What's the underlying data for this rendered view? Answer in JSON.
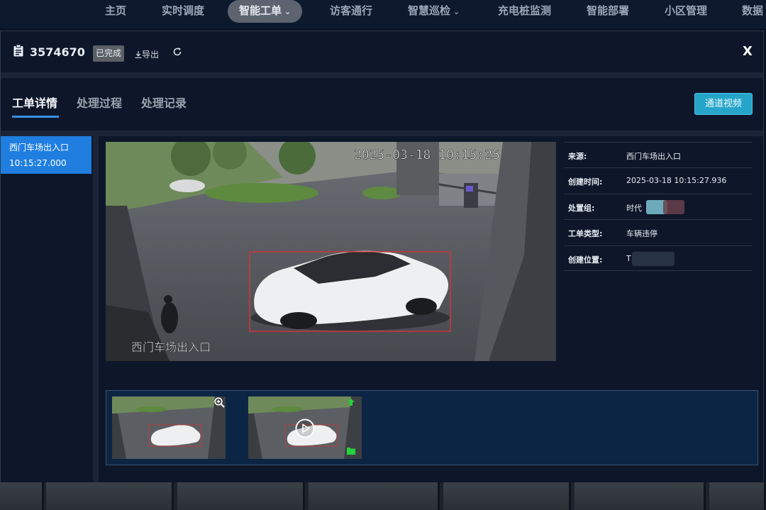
{
  "topnav": {
    "items": [
      {
        "label": "主页",
        "has_dropdown": false,
        "active": false
      },
      {
        "label": "实时调度",
        "has_dropdown": false,
        "active": false
      },
      {
        "label": "智能工单",
        "has_dropdown": true,
        "active": true
      },
      {
        "label": "访客通行",
        "has_dropdown": false,
        "active": false
      },
      {
        "label": "智慧巡检",
        "has_dropdown": true,
        "active": false
      },
      {
        "label": "充电桩监测",
        "has_dropdown": false,
        "active": false
      },
      {
        "label": "智能部署",
        "has_dropdown": false,
        "active": false
      },
      {
        "label": "小区管理",
        "has_dropdown": false,
        "active": false
      },
      {
        "label": "数据",
        "has_dropdown": false,
        "active": false
      }
    ],
    "chevron": "⌄"
  },
  "modal": {
    "order_id": "3574670",
    "status": "已完成",
    "export_label": "导出",
    "close_label": "X",
    "tabs": [
      {
        "label": "工单详情",
        "active": true
      },
      {
        "label": "处理过程",
        "active": false
      },
      {
        "label": "处理记录",
        "active": false
      }
    ],
    "channel_video_label": "通道视频",
    "sidebar": {
      "items": [
        {
          "line1": "西门车场出入口",
          "line2": "10:15:27.000",
          "active": true
        }
      ]
    },
    "snapshot": {
      "timestamp_overlay": "2025-03-18 10:15:25",
      "location_overlay": "西门车场出入口"
    },
    "details": [
      {
        "label": "来源:",
        "value": "西门车场出入口"
      },
      {
        "label": "创建时间:",
        "value": "2025-03-18 10:15:27.936"
      },
      {
        "label": "处置组:",
        "value": "时代"
      },
      {
        "label": "工单类型:",
        "value": "车辆违停"
      },
      {
        "label": "创建位置:",
        "value": "T"
      }
    ],
    "thumbnails": [
      {
        "kind": "image",
        "overlay_icon": "zoom-in-icon"
      },
      {
        "kind": "video",
        "overlay_icon": "play-icon"
      }
    ]
  },
  "colors": {
    "accent": "#1f7ee0",
    "video_button": "#25a5c9",
    "detection_box": "#d0343a",
    "upload_green": "#22d33a"
  }
}
